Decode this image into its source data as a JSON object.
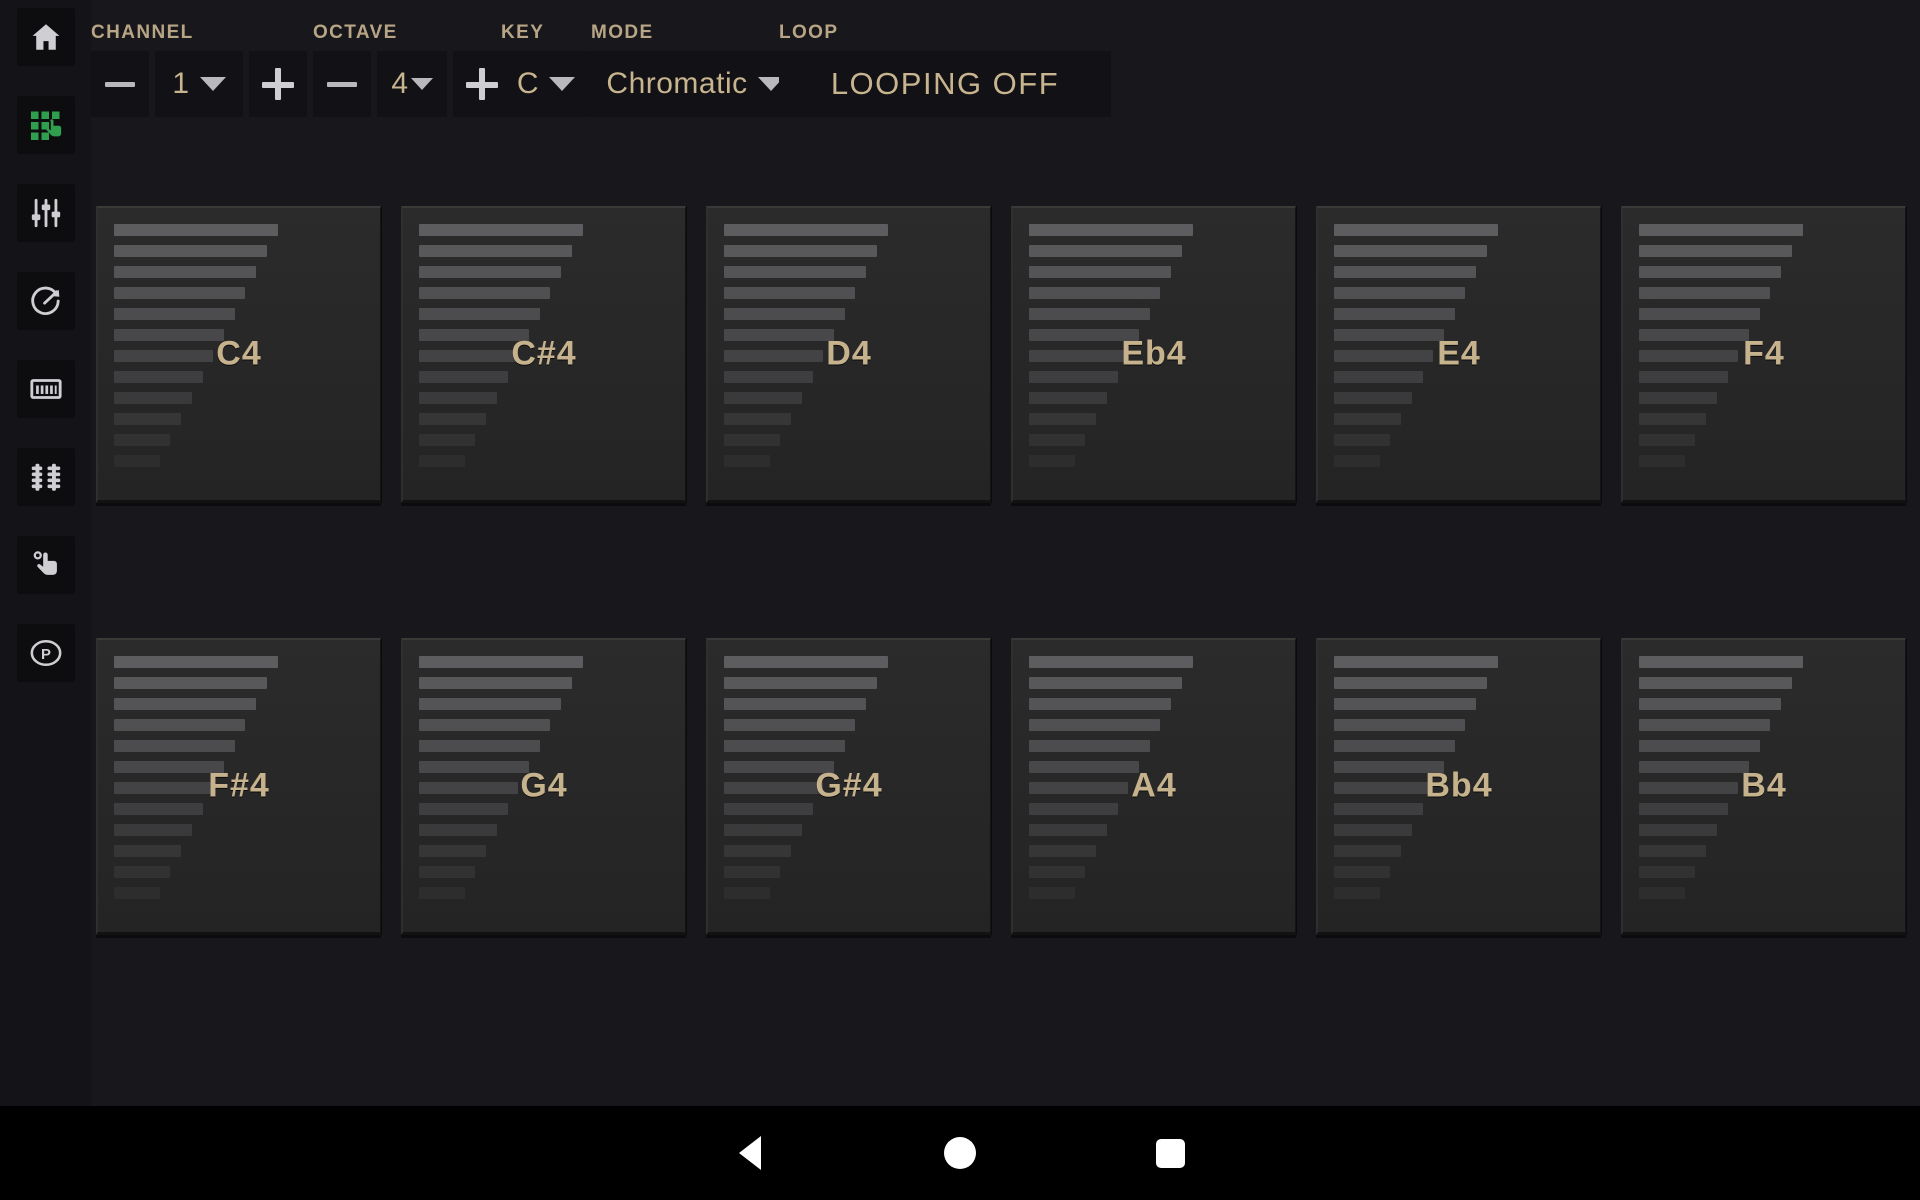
{
  "sidebar": {
    "items": [
      {
        "name": "home-icon",
        "label": "Home",
        "active": false
      },
      {
        "name": "pads-hand-icon",
        "label": "Pads",
        "active": true
      },
      {
        "name": "sliders-icon",
        "label": "Mixer",
        "active": false
      },
      {
        "name": "knob-icon",
        "label": "Knobs",
        "active": false
      },
      {
        "name": "keyboard-icon",
        "label": "Keyboard",
        "active": false
      },
      {
        "name": "faders-icon",
        "label": "Faders",
        "active": false
      },
      {
        "name": "touch-icon",
        "label": "XY Touch",
        "active": false
      },
      {
        "name": "preset-p-icon",
        "label": "Presets",
        "active": false
      }
    ],
    "active_color": "#34a853"
  },
  "controls": {
    "channel": {
      "label": "CHANNEL",
      "decrement": "—",
      "increment": "+",
      "value": "1"
    },
    "octave": {
      "label": "OCTAVE",
      "decrement": "—",
      "increment": "+",
      "value": "4"
    },
    "key": {
      "label": "KEY",
      "value": "C"
    },
    "mode": {
      "label": "MODE",
      "value": "Chromatic"
    },
    "loop": {
      "label": "LOOP",
      "value": "LOOPING OFF"
    }
  },
  "pads": {
    "rows": [
      [
        {
          "note": "C4",
          "velocity_bars": 12
        },
        {
          "note": "C#4",
          "velocity_bars": 12
        },
        {
          "note": "D4",
          "velocity_bars": 12
        },
        {
          "note": "Eb4",
          "velocity_bars": 12
        },
        {
          "note": "E4",
          "velocity_bars": 12
        },
        {
          "note": "F4",
          "velocity_bars": 12
        }
      ],
      [
        {
          "note": "F#4",
          "velocity_bars": 12
        },
        {
          "note": "G4",
          "velocity_bars": 12
        },
        {
          "note": "G#4",
          "velocity_bars": 12
        },
        {
          "note": "A4",
          "velocity_bars": 12
        },
        {
          "note": "Bb4",
          "velocity_bars": 12
        },
        {
          "note": "B4",
          "velocity_bars": 12
        }
      ]
    ]
  },
  "navbar": {
    "back": "back-triangle",
    "home": "home-circle",
    "recent": "recent-square"
  },
  "colors": {
    "accent_text": "#c8b48e",
    "label_text": "#b8a585",
    "pad_face": "#2a2a2a",
    "app_bg": "#17171c",
    "sidebar_bg": "#141418"
  }
}
